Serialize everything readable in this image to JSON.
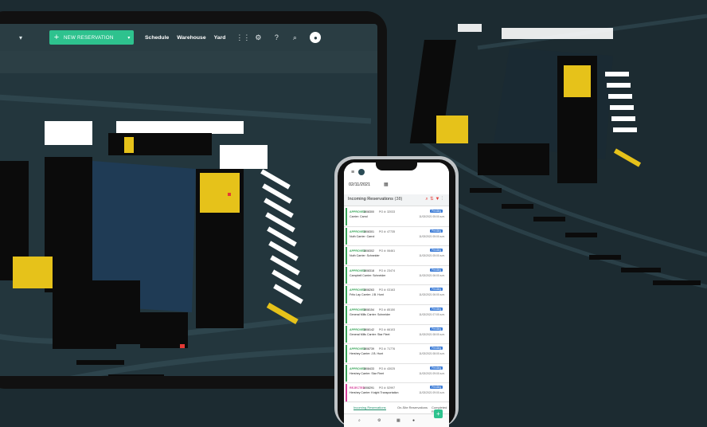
{
  "tablet": {
    "header": {
      "menu_caret": "▾",
      "new_reservation": {
        "plus": "+",
        "label": "NEW RESERVATION",
        "caret": "▾"
      },
      "nav": [
        "Schedule",
        "Warehouse",
        "Yard"
      ],
      "icons": [
        "apps-grid-icon",
        "settings-icon",
        "help-icon",
        "search-icon",
        "user-avatar-icon"
      ]
    }
  },
  "phone": {
    "date": "02/11/2021",
    "title": "Incoming Reservations",
    "count": "(38)",
    "rows": [
      {
        "status": "APPROVED",
        "id": "1008300",
        "po": "PO #: 32033",
        "who": "Carrier: Carrol",
        "tag": "Pending",
        "date": "11/02/2021 05:00 a.m."
      },
      {
        "status": "APPROVED",
        "id": "1008301",
        "po": "PO #: 47735",
        "who": "Nuth Carrier: Carrol",
        "tag": "Pending",
        "date": "11/02/2021 05:00 a.m."
      },
      {
        "status": "APPROVED",
        "id": "1008302",
        "po": "PO #: 06461",
        "who": "Nuth Carrier: Schneider",
        "tag": "Pending",
        "date": "11/02/2021 05:00 a.m."
      },
      {
        "status": "APPROVED",
        "id": "1008318",
        "po": "PO #: 23474",
        "who": "Campbell Carrier: Schneider",
        "tag": "Pending",
        "date": "11/02/2021 06:00 a.m."
      },
      {
        "status": "APPROVED",
        "id": "1008263",
        "po": "PO #: 03163",
        "who": "Frito Lay Carrier: J.B. Hunt",
        "tag": "Pending",
        "date": "11/02/2021 06:00 a.m."
      },
      {
        "status": "APPROVED",
        "id": "1008154",
        "po": "PO #: 85150",
        "who": "General Mills Carrier: Schneider",
        "tag": "Pending",
        "date": "11/02/2021 07:00 a.m."
      },
      {
        "status": "APPROVED",
        "id": "1008142",
        "po": "PO #: 66103",
        "who": "General Mills Carrier: Star Fleet",
        "tag": "Pending",
        "date": "11/02/2021 08:00 a.m."
      },
      {
        "status": "APPROVED",
        "id": "1008739",
        "po": "PO #: 71776",
        "who": "Hershey Carrier: J.B. Hunt",
        "tag": "Pending",
        "date": "11/02/2021 08:00 a.m."
      },
      {
        "status": "APPROVED",
        "id": "1008433",
        "po": "PO #: 43025",
        "who": "Hershey Carrier: Star Fleet",
        "tag": "Pending",
        "date": "11/02/2021 09:00 a.m."
      },
      {
        "status": "REJECTED",
        "id": "1008291",
        "po": "PO #: 52997",
        "who": "Hershey Carrier: Knight Transportation",
        "tag": "Pending",
        "date": "11/02/2021 09:00 a.m.",
        "rejected": true
      }
    ],
    "tabs": [
      "Incoming Reservations",
      "On-Site Reservations",
      "Completed R"
    ],
    "bottom_icons": [
      "search-icon",
      "settings-icon",
      "calendar-icon",
      "user-icon"
    ],
    "fab": "+"
  },
  "colors": {
    "accent": "#2ec28e",
    "background": "#1c2b31",
    "rejected": "#d63f9a",
    "approved": "#3aa55a",
    "highlight": "#e6c21a"
  }
}
